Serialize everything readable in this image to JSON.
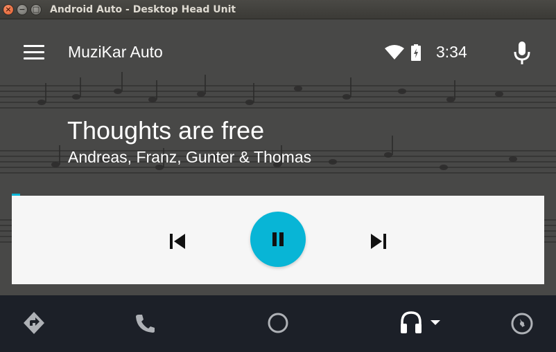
{
  "window": {
    "title": "Android Auto - Desktop Head Unit",
    "controls": {
      "close": "×",
      "minimize": "−",
      "maximize": "□"
    }
  },
  "appbar": {
    "app_name": "MuziKar Auto",
    "menu_icon": "hamburger-menu-icon",
    "status": {
      "wifi_icon": "wifi-icon",
      "battery_icon": "battery-charging-icon",
      "time": "3:34"
    },
    "mic_icon": "microphone-icon"
  },
  "now_playing": {
    "title": "Thoughts are free",
    "artist": "Andreas, Franz, Gunter & Thomas",
    "progress": 0.015,
    "background_art": "sheet-music-image"
  },
  "controls": {
    "previous_icon": "skip-previous-icon",
    "play_pause_icon": "pause-icon",
    "next_icon": "skip-next-icon",
    "accent_color": "#08b5d6"
  },
  "bottom_nav": {
    "items": [
      {
        "id": "navigation",
        "icon": "directions-icon"
      },
      {
        "id": "phone",
        "icon": "phone-icon"
      },
      {
        "id": "home",
        "icon": "home-circle-icon"
      },
      {
        "id": "media",
        "icon": "headphones-icon",
        "has_dropdown": true
      },
      {
        "id": "overview",
        "icon": "speedometer-icon"
      }
    ],
    "background_color": "#1c2028"
  }
}
